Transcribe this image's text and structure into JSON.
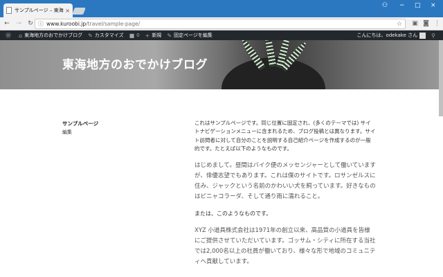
{
  "browser": {
    "tab_title": "サンプルページ – 東海地方のおでかけブログ",
    "tab_close": "×",
    "url_domain": "www.kuroobi.jp",
    "url_path": "/travel/sample-page/",
    "window_controls": [
      "−",
      "□",
      "×"
    ],
    "user_icon": "person-icon"
  },
  "adminbar": {
    "wp_logo": "wordpress-icon",
    "site_name": "東海地方のおでかけブログ",
    "customize": "カスタマイズ",
    "comments_count": "0",
    "new": "新規",
    "edit_page": "固定ページを編集",
    "greeting": "こんにちは、odekake さん"
  },
  "header": {
    "site_title": "東海地方のおでかけブログ"
  },
  "sidebar": {
    "page_title": "サンプルページ",
    "edit_link": "編集"
  },
  "content": {
    "p1": "これはサンプルページです。同じ位置に固定され、(多くのテーマでは) サイトナビゲーションメニューに含まれるため、ブログ投稿とは異なります。サイト訪問者に対して自分のことを説明する自己紹介ページを作成するのが一般的です。たとえば以下のようなものです。",
    "quote1": "はじめまして。昼間はバイク便のメッセンジャーとして働いていますが、俳優志望でもあります。これは僕のサイトです。ロサンゼルスに住み、ジャックという名前のかわいい犬を飼っています。好きなものはピニャコラーダ、そして通り雨に濡れること。",
    "p2": "または、このようなものです。",
    "quote2": "XYZ 小道具株式会社は1971年の創立以来、高品質の小道具を皆様にご提供させていただいています。ゴッサム・シティに所在する当社では2,000名以上の社員が働いており、様々な形で地域のコミュニティへ貢献しています。"
  }
}
